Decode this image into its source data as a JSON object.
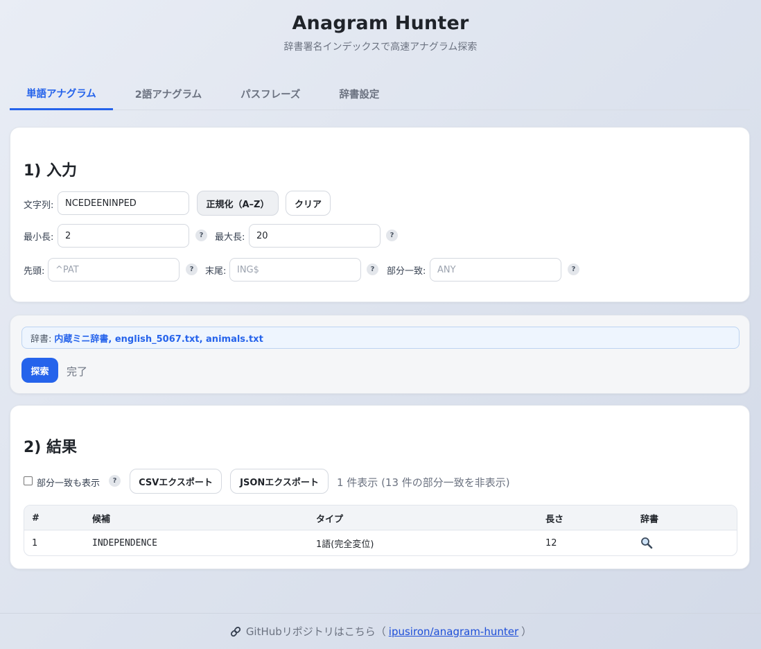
{
  "app": {
    "title": "Anagram Hunter",
    "subtitle": "辞書署名インデックスで高速アナグラム探索"
  },
  "tabs": [
    {
      "label": "単語アナグラム",
      "active": true
    },
    {
      "label": "2語アナグラム",
      "active": false
    },
    {
      "label": "パスフレーズ",
      "active": false
    },
    {
      "label": "辞書設定",
      "active": false
    }
  ],
  "input_section": {
    "title": "1) 入力",
    "string_label": "文字列:",
    "string_value": "NCEDEENINPED",
    "normalize_button": "正規化（A–Z）",
    "clear_button": "クリア",
    "min_len_label": "最小長:",
    "min_len_value": "2",
    "max_len_label": "最大長:",
    "max_len_value": "20",
    "prefix_label": "先頭:",
    "prefix_placeholder": "^PAT",
    "suffix_label": "末尾:",
    "suffix_placeholder": "ING$",
    "contains_label": "部分一致:",
    "contains_placeholder": "ANY",
    "help_glyph": "?"
  },
  "action": {
    "dict_label": "辞書:",
    "dict_list": "内蔵ミニ辞書, english_5067.txt, animals.txt",
    "search_button": "探索",
    "status": "完了"
  },
  "results": {
    "title": "2) 結果",
    "partial_checkbox_label": "部分一致も表示",
    "partial_checked": false,
    "csv_button": "CSVエクスポート",
    "json_button": "JSONエクスポート",
    "summary": "1 件表示 (13 件の部分一致を非表示)",
    "columns": [
      "#",
      "候補",
      "タイプ",
      "長さ",
      "辞書"
    ],
    "rows": [
      {
        "index": "1",
        "candidate": "INDEPENDENCE",
        "type": "1語(完全変位)",
        "length": "12",
        "dict_icon": "magnifier-icon"
      }
    ]
  },
  "footer": {
    "icon": "link-icon",
    "text": "GitHubリポジトリはこちら（",
    "link_text": "ipusiron/anagram-hunter",
    "close": "）"
  },
  "colors": {
    "accent": "#2563eb",
    "muted_text": "#6b7280",
    "card_bg": "#ffffff"
  }
}
